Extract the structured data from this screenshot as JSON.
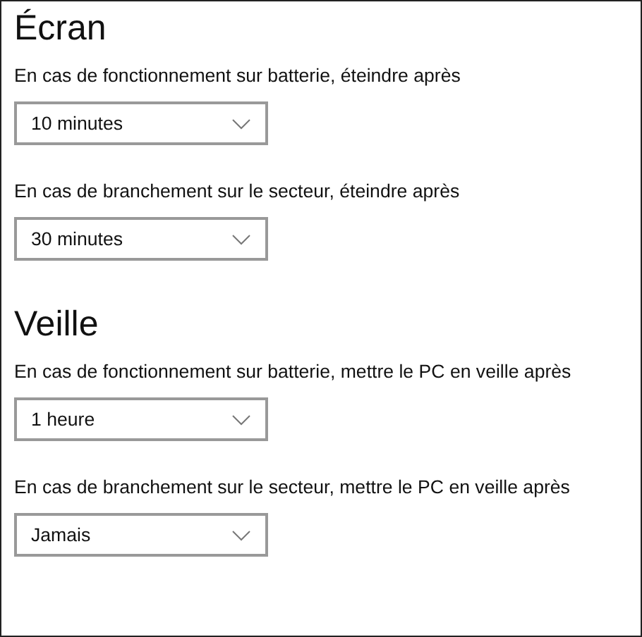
{
  "sections": [
    {
      "title": "Écran",
      "settings": [
        {
          "label": "En cas de fonctionnement sur batterie, éteindre après",
          "value": "10 minutes"
        },
        {
          "label": "En cas de branchement sur le secteur, éteindre après",
          "value": "30 minutes"
        }
      ]
    },
    {
      "title": "Veille",
      "settings": [
        {
          "label": "En cas de fonctionnement sur batterie, mettre le PC en veille après",
          "value": "1 heure"
        },
        {
          "label": "En cas de branchement sur le secteur, mettre le PC en veille après",
          "value": "Jamais"
        }
      ]
    }
  ]
}
